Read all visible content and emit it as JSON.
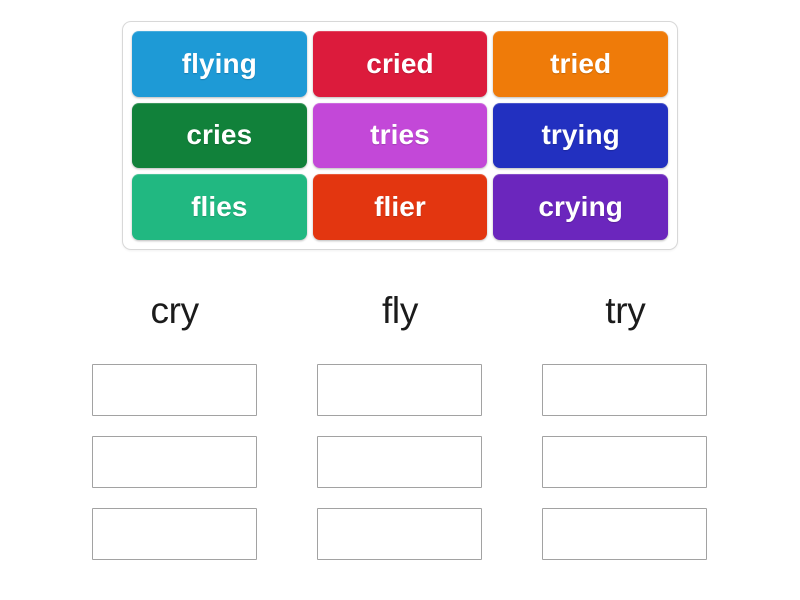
{
  "activity": {
    "type": "group-sort",
    "word_bank": {
      "tiles": [
        {
          "label": "flying",
          "color": "#1e9ad6"
        },
        {
          "label": "cried",
          "color": "#dc1b3c"
        },
        {
          "label": "tried",
          "color": "#ef7b09"
        },
        {
          "label": "cries",
          "color": "#11813a"
        },
        {
          "label": "tries",
          "color": "#c348d8"
        },
        {
          "label": "trying",
          "color": "#2230c0"
        },
        {
          "label": "flies",
          "color": "#21b881"
        },
        {
          "label": "flier",
          "color": "#e33610"
        },
        {
          "label": "crying",
          "color": "#6b26bd"
        }
      ]
    },
    "categories": [
      {
        "label": "cry",
        "slots": [
          "",
          "",
          ""
        ]
      },
      {
        "label": "fly",
        "slots": [
          "",
          "",
          ""
        ]
      },
      {
        "label": "try",
        "slots": [
          "",
          "",
          ""
        ]
      }
    ],
    "colors": {
      "page_background": "#ffffff",
      "container_border": "#d8d8d8",
      "drop_zone_border": "#a2a2a2",
      "header_text": "#1b1b1b",
      "tile_text": "#ffffff"
    }
  }
}
